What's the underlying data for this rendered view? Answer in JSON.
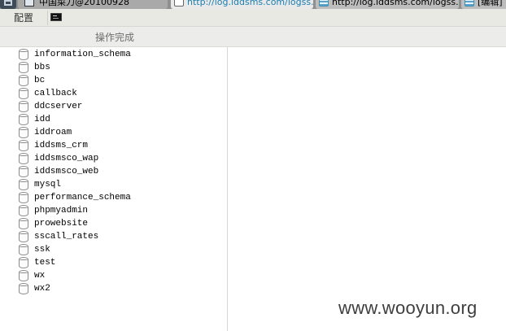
{
  "tabs": [
    {
      "title": "中国菜刀@20100928",
      "icon": "window-icon"
    },
    {
      "title": "http://log.iddsms.com/logss.p...",
      "icon": "page-icon",
      "active": true
    },
    {
      "title": "http://log.iddsms.com/logss.p...",
      "icon": "web-icon"
    },
    {
      "title": "[编辑]",
      "icon": "web-icon"
    }
  ],
  "toolbar": {
    "config_label": "配置",
    "terminal_icon": "terminal-icon"
  },
  "status": {
    "message": "操作完成"
  },
  "databases": [
    "information_schema",
    "bbs",
    "bc",
    "callback",
    "ddcserver",
    "idd",
    "iddroam",
    "iddsms_crm",
    "iddsmsco_wap",
    "iddsmsco_web",
    "mysql",
    "performance_schema",
    "phpmyadmin",
    "prowebsite",
    "sscall_rates",
    "ssk",
    "test",
    "wx",
    "wx2"
  ],
  "watermark": "www.wooyun.org",
  "colors": {
    "tab_active_text": "#1c7fb0",
    "toolbar_bg": "#e9e9e3",
    "status_text": "#6e6e6e"
  }
}
